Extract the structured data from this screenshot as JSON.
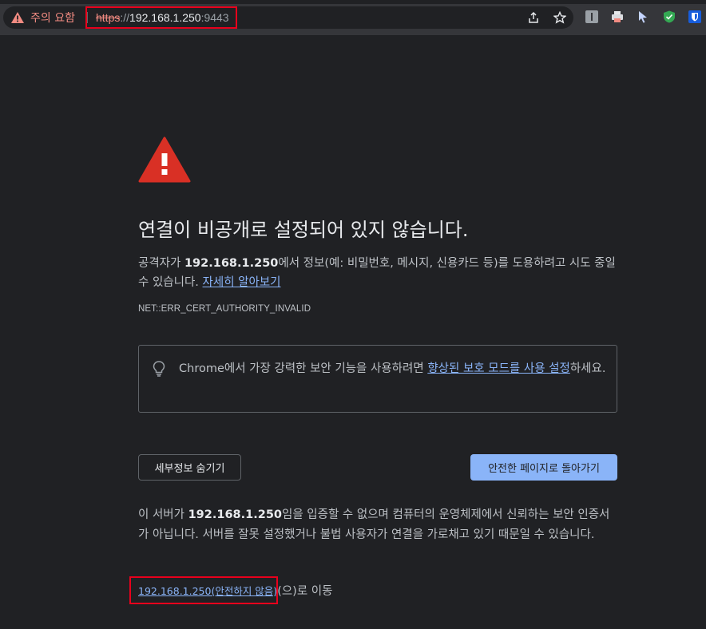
{
  "omnibox": {
    "security_chip_label": "주의 요함",
    "url_scheme": "https",
    "url_separator": "://",
    "url_host": "192.168.1.250",
    "url_port": ":9443"
  },
  "interstitial": {
    "title": "연결이 비공개로 설정되어 있지 않습니다.",
    "desc_prefix": "공격자가 ",
    "desc_host": "192.168.1.250",
    "desc_suffix": "에서 정보(예: 비밀번호, 메시지, 신용카드 등)를 도용하려고 시도 중일 수 있습니다. ",
    "learn_more_link": "자세히 알아보기",
    "error_code": "NET::ERR_CERT_AUTHORITY_INVALID",
    "tip_prefix": "Chrome에서 가장 강력한 보안 기능을 사용하려면 ",
    "tip_link": "향상된 보호 모드를 사용 설정",
    "tip_suffix": "하세요.",
    "details_button": "세부정보 숨기기",
    "back_button": "안전한 페이지로 돌아가기",
    "detail_prefix": "이 서버가 ",
    "detail_host": "192.168.1.250",
    "detail_suffix": "임을 입증할 수 없으며 컴퓨터의 운영체제에서 신뢰하는 보안 인증서가 아닙니다. 서버를 잘못 설정했거나 불법 사용자가 연결을 가로채고 있기 때문일 수 있습니다.",
    "proceed_link": "192.168.1.250(안전하지 않음)",
    "proceed_suffix": "(으)로 이동"
  },
  "colors": {
    "background": "#202124",
    "toolbar": "#35363a",
    "warning_red": "#d93025",
    "link_blue": "#8ab4f8",
    "highlight_red": "#e8001c"
  },
  "icons": [
    "warning-triangle-icon",
    "share-icon",
    "bookmark-star-icon",
    "extension-icon",
    "lightbulb-icon",
    "large-warning-icon"
  ]
}
